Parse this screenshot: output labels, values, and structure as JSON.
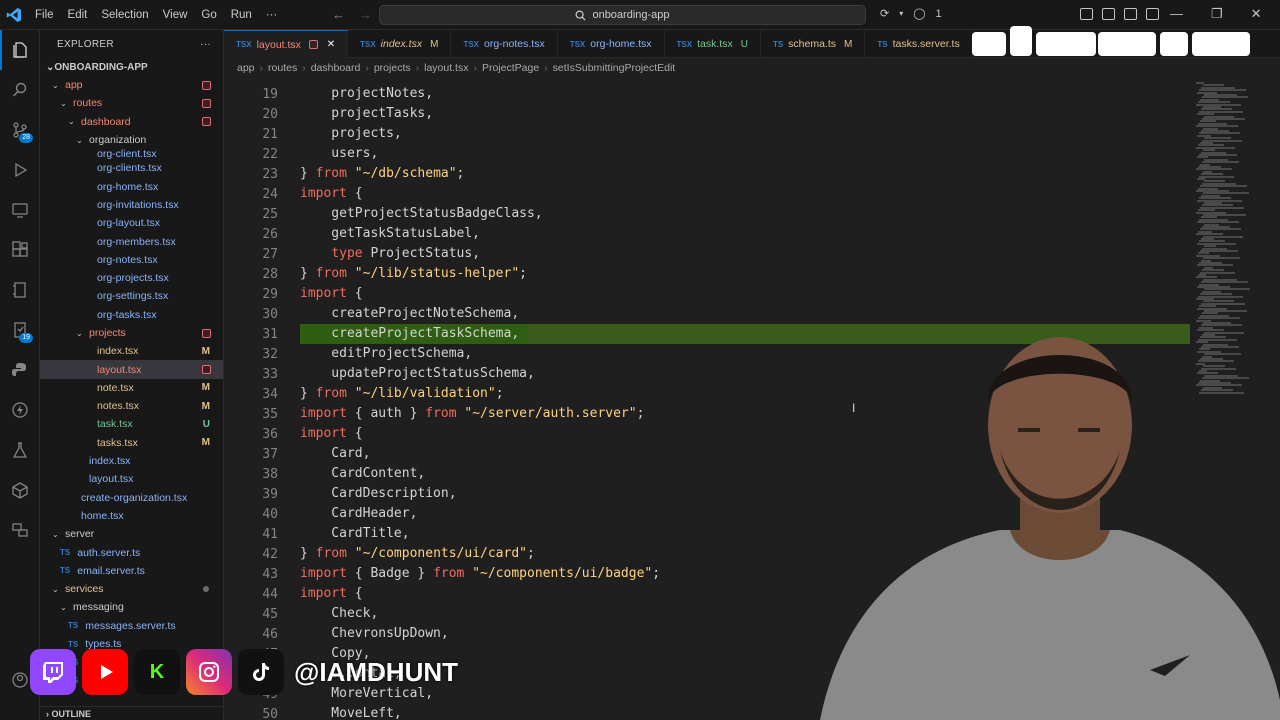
{
  "window": {
    "menu": [
      "File",
      "Edit",
      "Selection",
      "View",
      "Go",
      "Run",
      "···"
    ],
    "search_text": "onboarding-app",
    "title_right_count": "1"
  },
  "activity_bar": {
    "source_control_badge": "28",
    "extensions_badge": "19"
  },
  "explorer": {
    "header": "EXPLORER",
    "more": "···",
    "project": "ONBOARDING-APP",
    "outline": "OUTLINE",
    "tree": [
      {
        "label": "app",
        "indent": 1,
        "type": "folder",
        "color": "red",
        "dot": true
      },
      {
        "label": "routes",
        "indent": 2,
        "type": "folder",
        "color": "red",
        "dot": true
      },
      {
        "label": "dashboard",
        "indent": 3,
        "type": "folder",
        "color": "red",
        "dot": true
      },
      {
        "label": "organization",
        "indent": 4,
        "type": "folder",
        "color": "dim"
      },
      {
        "label": "org-client.tsx",
        "indent": 5,
        "type": "file",
        "color": "file"
      },
      {
        "label": "org-clients.tsx",
        "indent": 5,
        "type": "file",
        "color": "file"
      },
      {
        "label": "org-home.tsx",
        "indent": 5,
        "type": "file",
        "color": "file"
      },
      {
        "label": "org-invitations.tsx",
        "indent": 5,
        "type": "file",
        "color": "file"
      },
      {
        "label": "org-layout.tsx",
        "indent": 5,
        "type": "file",
        "color": "file"
      },
      {
        "label": "org-members.tsx",
        "indent": 5,
        "type": "file",
        "color": "file"
      },
      {
        "label": "org-notes.tsx",
        "indent": 5,
        "type": "file",
        "color": "file"
      },
      {
        "label": "org-projects.tsx",
        "indent": 5,
        "type": "file",
        "color": "file"
      },
      {
        "label": "org-settings.tsx",
        "indent": 5,
        "type": "file",
        "color": "file"
      },
      {
        "label": "org-tasks.tsx",
        "indent": 5,
        "type": "file",
        "color": "file"
      },
      {
        "label": "projects",
        "indent": 4,
        "type": "folder",
        "color": "red",
        "dot": true
      },
      {
        "label": "index.tsx",
        "indent": 5,
        "type": "file",
        "color": "mod",
        "dec": "M"
      },
      {
        "label": "layout.tsx",
        "indent": 5,
        "type": "file",
        "color": "red",
        "dot": true,
        "selected": true
      },
      {
        "label": "note.tsx",
        "indent": 5,
        "type": "file",
        "color": "mod",
        "dec": "M"
      },
      {
        "label": "notes.tsx",
        "indent": 5,
        "type": "file",
        "color": "mod",
        "dec": "M"
      },
      {
        "label": "task.tsx",
        "indent": 5,
        "type": "file",
        "color": "new",
        "dec": "U"
      },
      {
        "label": "tasks.tsx",
        "indent": 5,
        "type": "file",
        "color": "mod",
        "dec": "M"
      },
      {
        "label": "index.tsx",
        "indent": 4,
        "type": "file",
        "color": "file"
      },
      {
        "label": "layout.tsx",
        "indent": 4,
        "type": "file",
        "color": "file"
      },
      {
        "label": "create-organization.tsx",
        "indent": 3,
        "type": "file",
        "color": "file"
      },
      {
        "label": "home.tsx",
        "indent": 3,
        "type": "file",
        "color": "file"
      },
      {
        "label": "server",
        "indent": 1,
        "type": "folder",
        "color": "dim"
      },
      {
        "label": "auth.server.ts",
        "indent": 2,
        "type": "ts",
        "color": "file"
      },
      {
        "label": "email.server.ts",
        "indent": 2,
        "type": "ts",
        "color": "file"
      },
      {
        "label": "services",
        "indent": 1,
        "type": "folder",
        "color": "mod",
        "dotgray": true
      },
      {
        "label": "messaging",
        "indent": 2,
        "type": "folder",
        "color": "dim"
      },
      {
        "label": "messages.server.ts",
        "indent": 3,
        "type": "ts",
        "color": "file"
      },
      {
        "label": "types.ts",
        "indent": 3,
        "type": "ts",
        "color": "file"
      },
      {
        "label": "types.ts",
        "indent": 3,
        "type": "ts",
        "color": "file"
      },
      {
        "label": "types.ts",
        "indent": 3,
        "type": "ts",
        "color": "file"
      }
    ]
  },
  "tabs": [
    {
      "label": "layout.tsx",
      "icon": "TSX",
      "color": "red",
      "active": true,
      "dec": "close"
    },
    {
      "label": "index.tsx",
      "icon": "TSX",
      "color": "mod",
      "dec": "M",
      "italic": true
    },
    {
      "label": "org-notes.tsx",
      "icon": "TSX",
      "color": "file"
    },
    {
      "label": "org-home.tsx",
      "icon": "TSX",
      "color": "file"
    },
    {
      "label": "task.tsx",
      "icon": "TSX",
      "color": "new",
      "dec": "U"
    },
    {
      "label": "schema.ts",
      "icon": "TS",
      "color": "mod",
      "dec": "M"
    },
    {
      "label": "tasks.server.ts",
      "icon": "TS",
      "color": "mod"
    }
  ],
  "breadcrumbs": [
    "app",
    "routes",
    "dashboard",
    "projects",
    "layout.tsx",
    "ProjectPage",
    "setIsSubmittingProjectEdit"
  ],
  "code": [
    {
      "n": 19,
      "t": "    projectNotes,"
    },
    {
      "n": 20,
      "t": "    projectTasks,"
    },
    {
      "n": 21,
      "t": "    projects,"
    },
    {
      "n": 22,
      "t": "    users,"
    },
    {
      "n": 23,
      "t": "} from \"~/db/schema\";"
    },
    {
      "n": 24,
      "t": "import {"
    },
    {
      "n": 25,
      "t": "    getProjectStatusBadgeClass,"
    },
    {
      "n": 26,
      "t": "    getTaskStatusLabel,"
    },
    {
      "n": 27,
      "t": "    type ProjectStatus,"
    },
    {
      "n": 28,
      "t": "} from \"~/lib/status-helper\";"
    },
    {
      "n": 29,
      "t": "import {"
    },
    {
      "n": 30,
      "t": "    createProjectNoteSchema,"
    },
    {
      "n": 31,
      "t": "    createProjectTaskSchema,",
      "hl": true
    },
    {
      "n": 32,
      "t": "    editProjectSchema,"
    },
    {
      "n": 33,
      "t": "    updateProjectStatusSchema,"
    },
    {
      "n": 34,
      "t": "} from \"~/lib/validation\";"
    },
    {
      "n": 35,
      "t": "import { auth } from \"~/server/auth.server\";"
    },
    {
      "n": 36,
      "t": "import {"
    },
    {
      "n": 37,
      "t": "    Card,"
    },
    {
      "n": 38,
      "t": "    CardContent,"
    },
    {
      "n": 39,
      "t": "    CardDescription,"
    },
    {
      "n": 40,
      "t": "    CardHeader,"
    },
    {
      "n": 41,
      "t": "    CardTitle,"
    },
    {
      "n": 42,
      "t": "} from \"~/components/ui/card\";"
    },
    {
      "n": 43,
      "t": "import { Badge } from \"~/components/ui/badge\";"
    },
    {
      "n": 44,
      "t": "import {"
    },
    {
      "n": 45,
      "t": "    Check,"
    },
    {
      "n": 46,
      "t": "    ChevronsUpDown,"
    },
    {
      "n": 47,
      "t": "    Copy,"
    },
    {
      "n": 48,
      "t": "    ...ontal,"
    },
    {
      "n": 49,
      "t": "    MoreVertical,"
    },
    {
      "n": 50,
      "t": "    MoveLeft,"
    }
  ],
  "overlay": {
    "handle": "@IAMDHUNT"
  },
  "colors": {
    "accent": "#0078d4",
    "highlight": "#3a5c1a",
    "keyword": "#f16b5f",
    "string": "#ffd27a"
  }
}
